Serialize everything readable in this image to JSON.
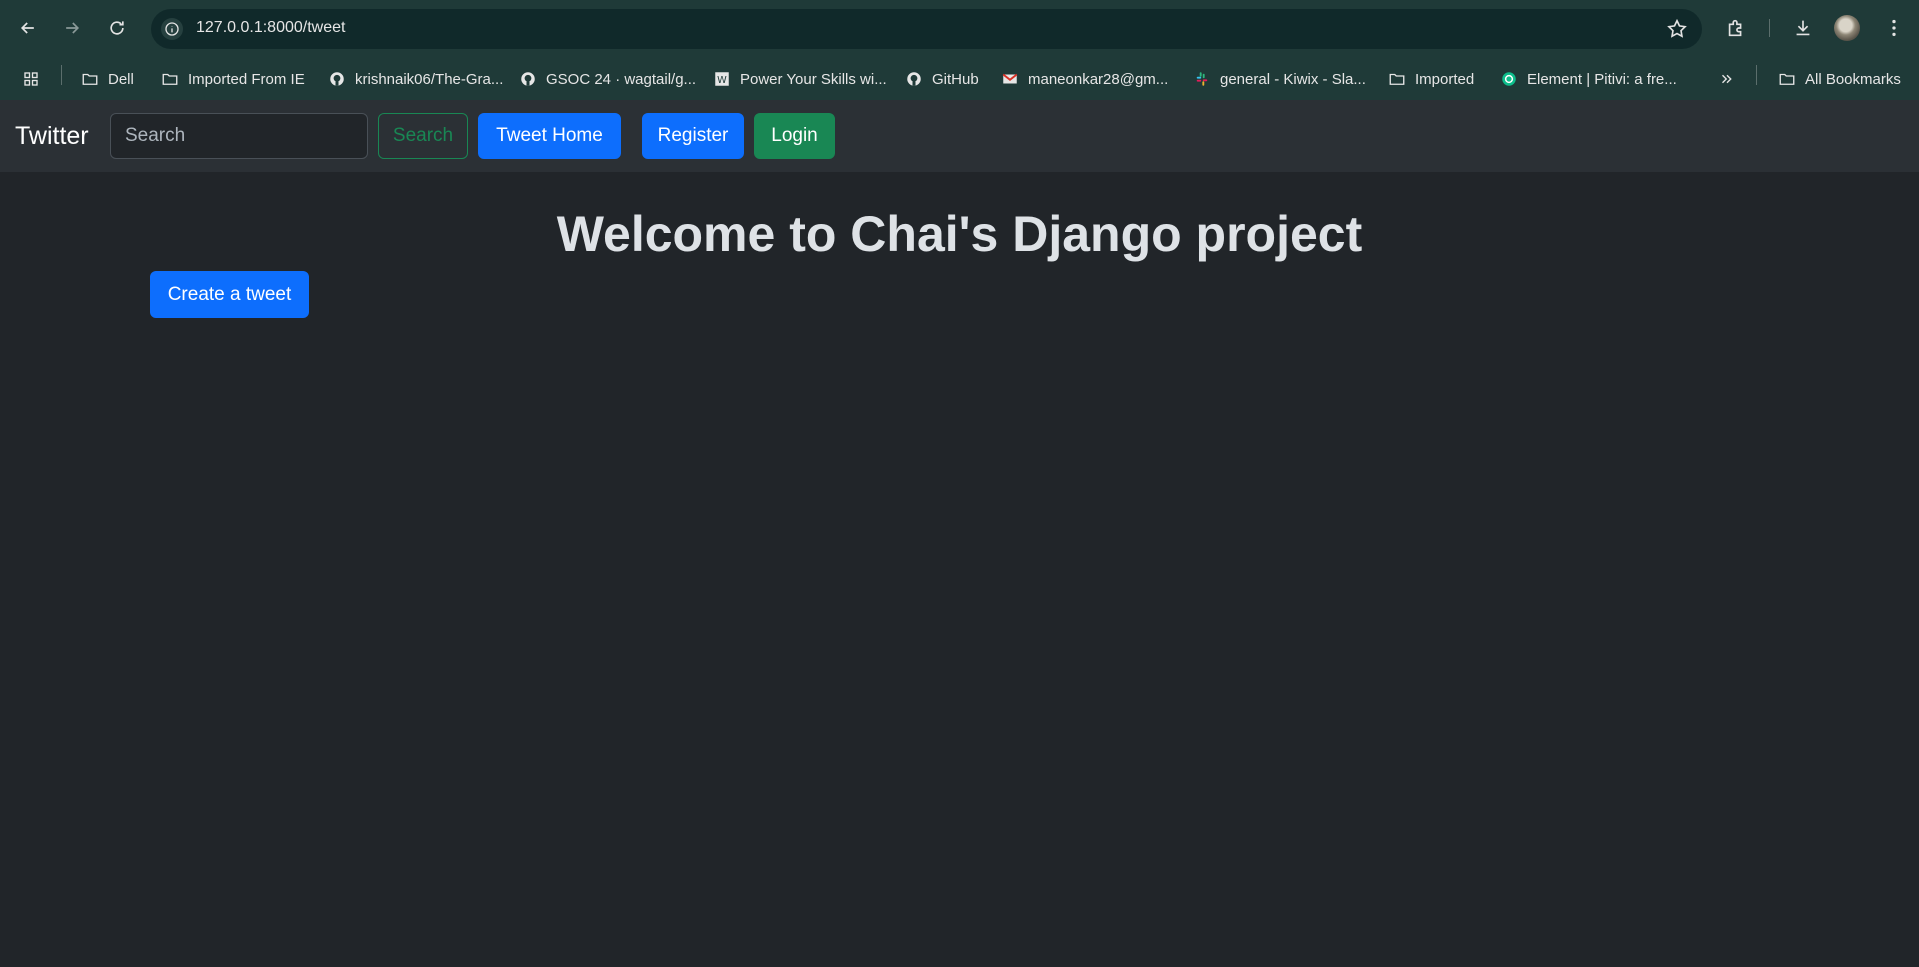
{
  "browser": {
    "url": "127.0.0.1:8000/tweet",
    "bookmarks": [
      {
        "label": "Dell",
        "icon": "folder-icon"
      },
      {
        "label": "Imported From IE",
        "icon": "folder-icon"
      },
      {
        "label": "krishnaik06/The-Gra...",
        "icon": "github-icon"
      },
      {
        "label": "GSOC 24 · wagtail/g...",
        "icon": "github-icon"
      },
      {
        "label": "Power Your Skills wi...",
        "icon": "wordpress-icon"
      },
      {
        "label": "GitHub",
        "icon": "github-icon"
      },
      {
        "label": "maneonkar28@gm...",
        "icon": "gmail-icon"
      },
      {
        "label": "general - Kiwix - Sla...",
        "icon": "slack-icon"
      },
      {
        "label": "Imported",
        "icon": "folder-icon"
      },
      {
        "label": "Element | Pitivi: a fre...",
        "icon": "element-icon"
      }
    ],
    "all_bookmarks_label": "All Bookmarks"
  },
  "navbar": {
    "brand": "Twitter",
    "search_placeholder": "Search",
    "search_button": "Search",
    "tweet_home": "Tweet Home",
    "register": "Register",
    "login": "Login"
  },
  "main": {
    "title": "Welcome to Chai's Django project",
    "create_button": "Create a tweet"
  },
  "colors": {
    "primary": "#0d6efd",
    "success": "#198754",
    "background": "#212529",
    "navbar": "#2b3035"
  }
}
